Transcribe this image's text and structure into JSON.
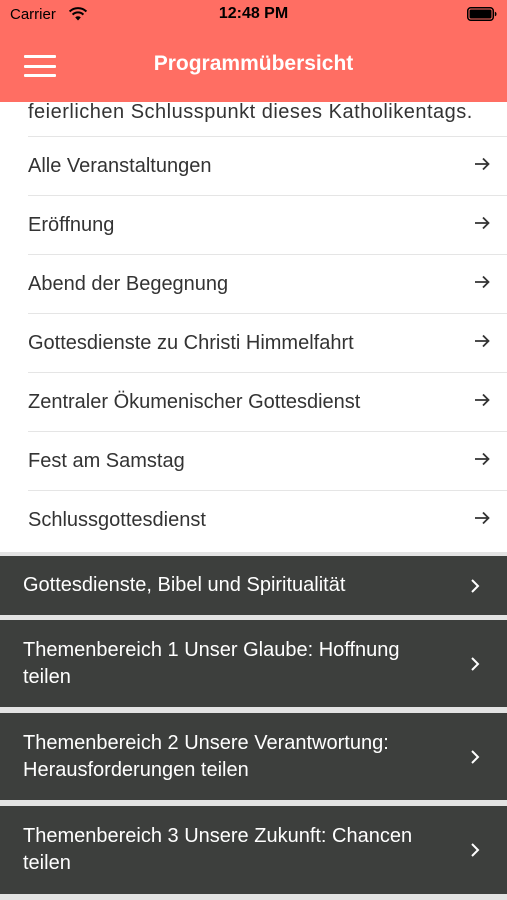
{
  "status_bar": {
    "carrier": "Carrier",
    "time": "12:48 PM"
  },
  "header": {
    "title": "Programmübersicht",
    "background_color": "#ff6e63"
  },
  "intro_text": "feierlichen Schlusspunkt dieses Katholikentags.",
  "sub_items": [
    {
      "label": "Alle Veranstaltungen",
      "icon": "arrow-right-icon"
    },
    {
      "label": "Eröffnung",
      "icon": "arrow-right-icon"
    },
    {
      "label": "Abend der Begegnung",
      "icon": "arrow-right-icon"
    },
    {
      "label": "Gottesdienste zu Christi Himmelfahrt",
      "icon": "arrow-right-icon"
    },
    {
      "label": "Zentraler Ökumenischer Gottesdienst",
      "icon": "arrow-right-icon"
    },
    {
      "label": "Fest am Samstag",
      "icon": "arrow-right-icon"
    },
    {
      "label": "Schlussgottesdienst",
      "icon": "arrow-right-icon"
    }
  ],
  "sections": [
    {
      "label": "Gottesdienste, Bibel und Spiritualität",
      "icon": "chevron-right-icon"
    },
    {
      "label": "Themenbereich 1 Unser Glaube: Hoffnung teilen",
      "icon": "chevron-right-icon"
    },
    {
      "label": "Themenbereich 2 Unsere Verantwortung: Herausforderungen teilen",
      "icon": "chevron-right-icon"
    },
    {
      "label": "Themenbereich 3 Unsere Zukunft: Chancen teilen",
      "icon": "chevron-right-icon"
    }
  ],
  "colors": {
    "accent": "#ff6e63",
    "section_background": "#3d3f3d",
    "list_background": "#ffffff",
    "separator": "#e3e3e3"
  }
}
